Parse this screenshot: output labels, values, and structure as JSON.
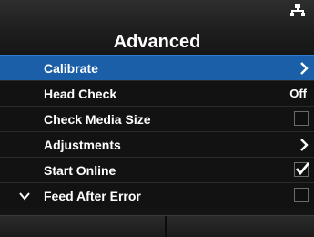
{
  "header": {
    "title": "Advanced",
    "status_icon": "network-icon"
  },
  "menu": {
    "items": [
      {
        "label": "Calibrate",
        "control": "chevron-right-icon",
        "selected": true
      },
      {
        "label": "Head Check",
        "value": "Off"
      },
      {
        "label": "Check Media Size",
        "control": "checkbox",
        "checked": false
      },
      {
        "label": "Adjustments",
        "control": "chevron-right-icon"
      },
      {
        "label": "Start Online",
        "control": "checkbox",
        "checked": true
      },
      {
        "label": "Feed After Error",
        "control": "checkbox",
        "checked": false,
        "marker": "chevron-down-icon"
      }
    ]
  },
  "colors": {
    "selected_row": "#1a5fa8",
    "background": "#141414",
    "text": "#ffffff"
  }
}
